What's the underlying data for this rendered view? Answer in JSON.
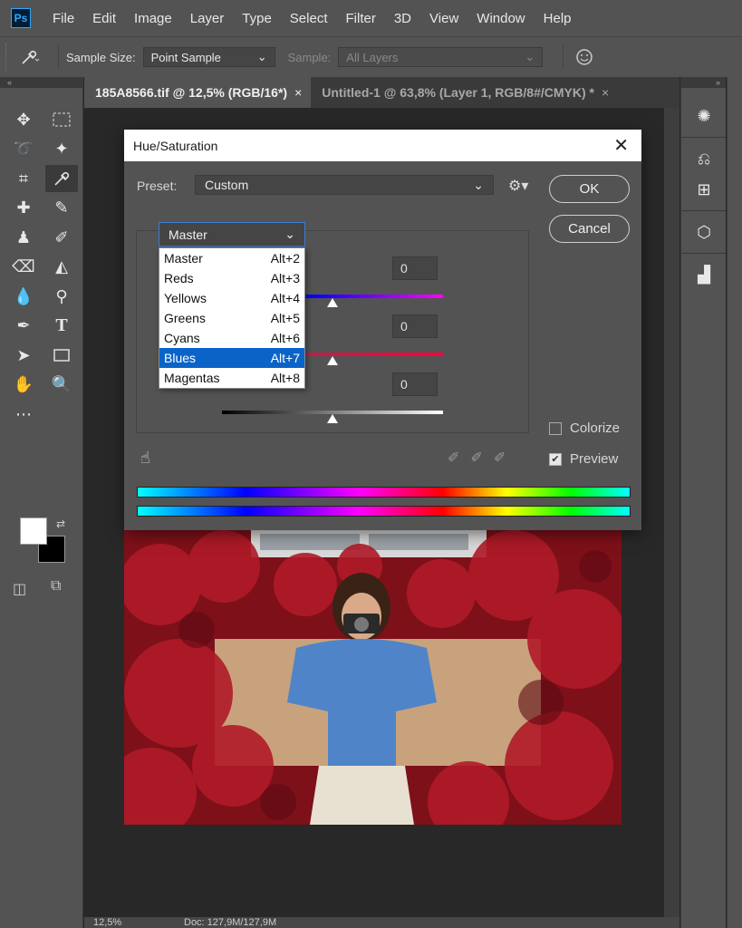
{
  "menubar": {
    "logo": "Ps",
    "items": [
      "File",
      "Edit",
      "Image",
      "Layer",
      "Type",
      "Select",
      "Filter",
      "3D",
      "View",
      "Window",
      "Help"
    ]
  },
  "options": {
    "sample_size_label": "Sample Size:",
    "sample_size_value": "Point Sample",
    "sample_label": "Sample:",
    "sample_value": "All Layers"
  },
  "tabs": [
    {
      "label": "185A8566.tif @ 12,5% (RGB/16*)",
      "close": "×"
    },
    {
      "label": "Untitled-1 @ 63,8% (Layer 1, RGB/8#/CMYK) *",
      "close": "×"
    }
  ],
  "status": {
    "zoom": "12,5%",
    "doc": "Doc: 127,9M/127,9M"
  },
  "dialog": {
    "title": "Hue/Saturation",
    "close": "✕",
    "preset_label": "Preset:",
    "preset_value": "Custom",
    "ok_label": "OK",
    "cancel_label": "Cancel",
    "channel_value": "Master",
    "hue_value": "0",
    "saturation_value": "0",
    "lightness_value": "0",
    "colorize_label": "Colorize",
    "colorize_checked": false,
    "preview_label": "Preview",
    "preview_checked": true,
    "channels": [
      {
        "name": "Master",
        "shortcut": "Alt+2"
      },
      {
        "name": "Reds",
        "shortcut": "Alt+3"
      },
      {
        "name": "Yellows",
        "shortcut": "Alt+4"
      },
      {
        "name": "Greens",
        "shortcut": "Alt+5"
      },
      {
        "name": "Cyans",
        "shortcut": "Alt+6"
      },
      {
        "name": "Blues",
        "shortcut": "Alt+7"
      },
      {
        "name": "Magentas",
        "shortcut": "Alt+8"
      }
    ],
    "selected_channel": "Blues"
  },
  "colors": {
    "accent": "#0a64c8",
    "panel": "#535353",
    "canvas": "#282828"
  }
}
